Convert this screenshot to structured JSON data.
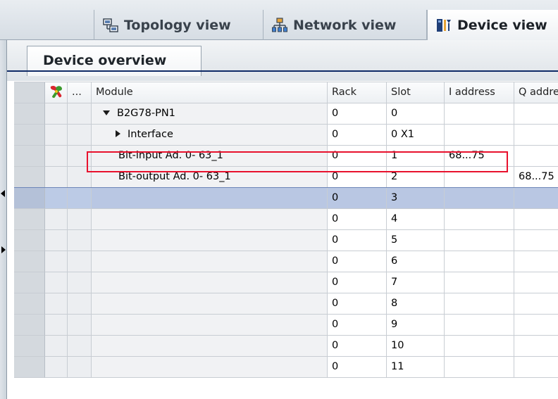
{
  "view_tabs": [
    {
      "label": "Topology view",
      "icon": "topology-icon",
      "active": false
    },
    {
      "label": "Network view",
      "icon": "network-icon",
      "active": false
    },
    {
      "label": "Device view",
      "icon": "device-icon",
      "active": true
    }
  ],
  "overview_tab": {
    "label": "Device overview"
  },
  "table": {
    "header": {
      "c1_icon": "wrench-icon",
      "c2": "...",
      "module": "Module",
      "rack": "Rack",
      "slot": "Slot",
      "i_address": "I address",
      "q_address": "Q addre"
    },
    "rows": [
      {
        "module": "B2G78-PN1",
        "rack": "0",
        "slot": "0",
        "i_address": "",
        "q_address": ""
      },
      {
        "module": "Interface",
        "rack": "0",
        "slot": "0 X1",
        "i_address": "",
        "q_address": ""
      },
      {
        "module": "Bit-input Ad. 0- 63_1",
        "rack": "0",
        "slot": "1",
        "i_address": "68...75",
        "q_address": ""
      },
      {
        "module": "Bit-output Ad. 0- 63_1",
        "rack": "0",
        "slot": "2",
        "i_address": "",
        "q_address": "68...75"
      },
      {
        "module": "",
        "rack": "0",
        "slot": "3",
        "i_address": "",
        "q_address": ""
      },
      {
        "module": "",
        "rack": "0",
        "slot": "4",
        "i_address": "",
        "q_address": ""
      },
      {
        "module": "",
        "rack": "0",
        "slot": "5",
        "i_address": "",
        "q_address": ""
      },
      {
        "module": "",
        "rack": "0",
        "slot": "6",
        "i_address": "",
        "q_address": ""
      },
      {
        "module": "",
        "rack": "0",
        "slot": "7",
        "i_address": "",
        "q_address": ""
      },
      {
        "module": "",
        "rack": "0",
        "slot": "8",
        "i_address": "",
        "q_address": ""
      },
      {
        "module": "",
        "rack": "0",
        "slot": "9",
        "i_address": "",
        "q_address": ""
      },
      {
        "module": "",
        "rack": "0",
        "slot": "10",
        "i_address": "",
        "q_address": ""
      },
      {
        "module": "",
        "rack": "0",
        "slot": "11",
        "i_address": "",
        "q_address": ""
      }
    ],
    "selected_row": 4,
    "highlighted_row": 2
  },
  "colors": {
    "selection": "#b9c7e3",
    "highlight_border": "#e8112d",
    "accent_rule": "#0f2a66"
  }
}
